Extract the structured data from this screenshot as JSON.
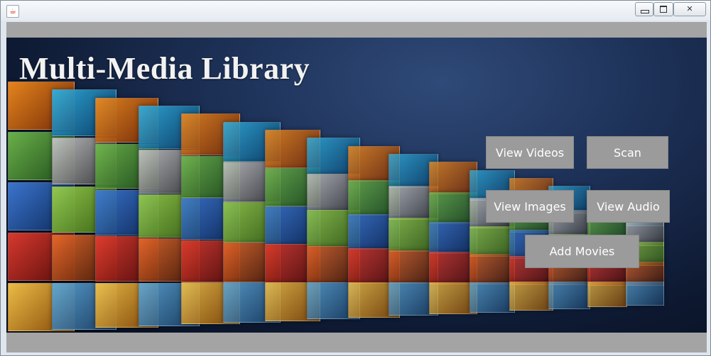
{
  "window": {
    "controls": {
      "minimize": "",
      "maximize": "",
      "close": "✕"
    }
  },
  "banner": {
    "title": "Multi-Media Library"
  },
  "buttons": {
    "view_videos": "View Videos",
    "scan": "Scan",
    "view_images": "View Images",
    "view_audio": "View Audio",
    "add_movies": "Add Movies"
  },
  "colors": {
    "button_bg": "#9b9b9b",
    "frame_bg": "#a4a4a4",
    "banner_dark": "#0e1a33",
    "banner_light": "#2f4a78"
  }
}
